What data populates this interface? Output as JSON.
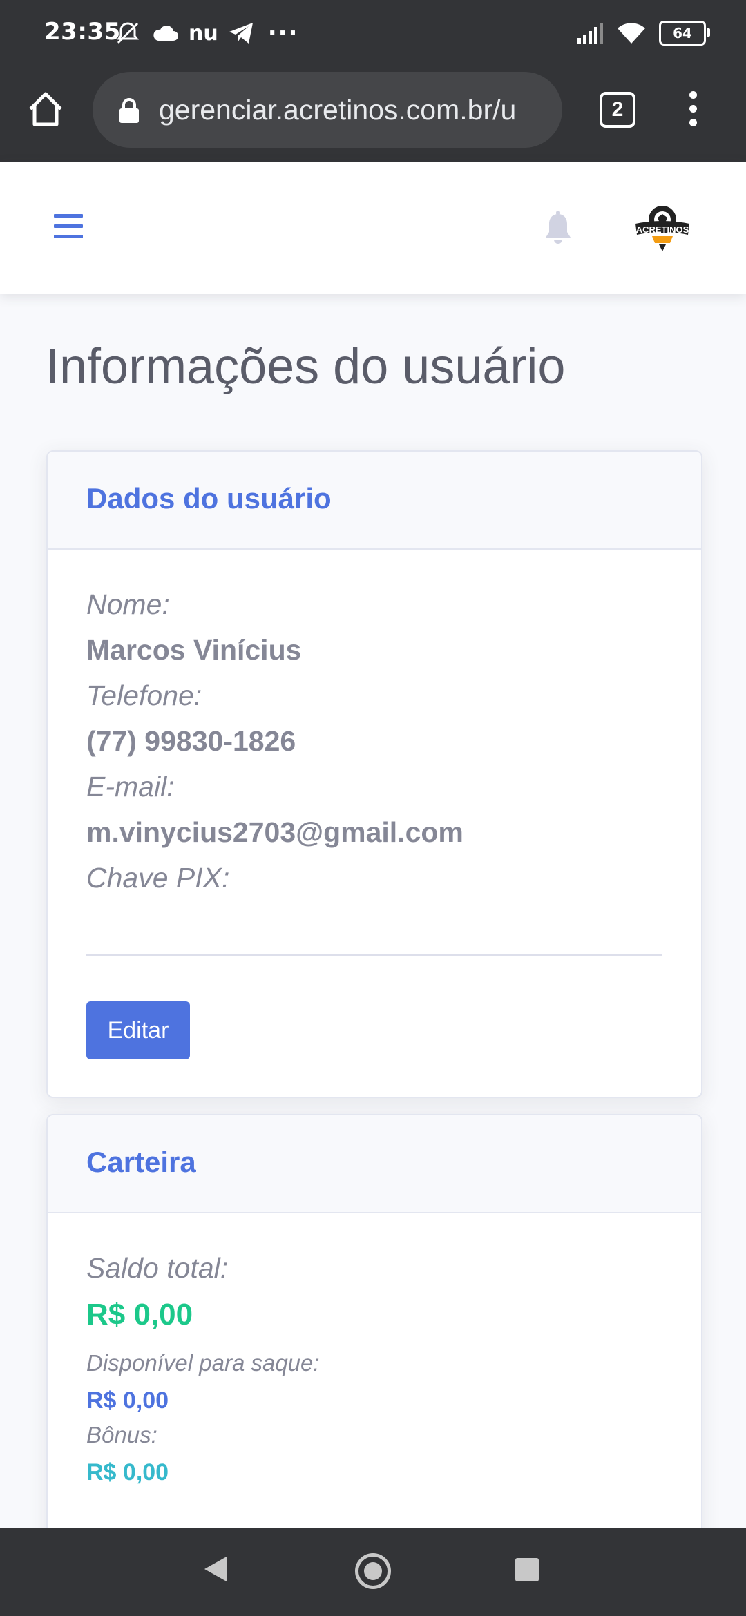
{
  "status_bar": {
    "time": "23:35",
    "carrier_icon_text": "nu",
    "more_indicator": "···",
    "battery": "64"
  },
  "browser": {
    "url": "gerenciar.acretinos.com.br/u",
    "tab_count": "2"
  },
  "app": {
    "logo_text": "ACRETINOS"
  },
  "page": {
    "title": "Informações do usuário"
  },
  "user_card": {
    "header": "Dados do usuário",
    "name_label": "Nome:",
    "name_value": "Marcos Vinícius",
    "phone_label": "Telefone:",
    "phone_value": "(77) 99830-1826",
    "email_label": "E-mail:",
    "email_value": "m.vinycius2703@gmail.com",
    "pix_label": "Chave PIX:",
    "pix_value": "",
    "edit_button": "Editar"
  },
  "wallet_card": {
    "header": "Carteira",
    "total_label": "Saldo total:",
    "total_value": "R$ 0,00",
    "available_label": "Disponível para saque:",
    "available_value": "R$ 0,00",
    "bonus_label": "Bônus:",
    "bonus_value": "R$ 0,00"
  },
  "colors": {
    "primary": "#4e73df",
    "success": "#1cc88a",
    "info": "#36b9cc",
    "text_muted": "#858796",
    "chrome_dark": "#333437"
  }
}
